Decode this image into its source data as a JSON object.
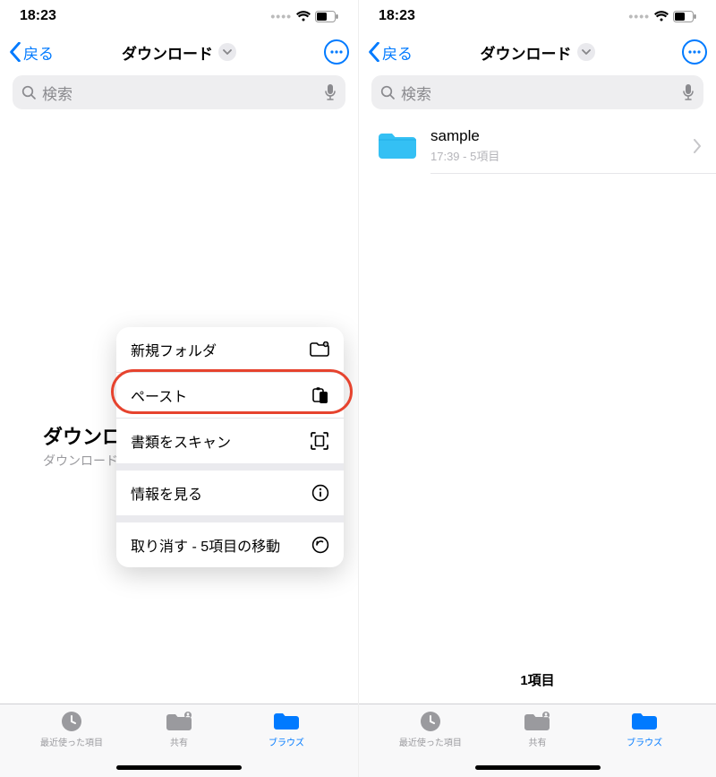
{
  "status": {
    "time": "18:23"
  },
  "nav": {
    "back": "戻る",
    "title": "ダウンロード"
  },
  "search": {
    "placeholder": "検索"
  },
  "empty": {
    "title": "ダウンロ",
    "subtitle": "ダウンロード"
  },
  "menu": {
    "newFolder": "新規フォルダ",
    "paste": "ペースト",
    "scan": "書類をスキャン",
    "info": "情報を見る",
    "undo": "取り消す - 5項目の移動"
  },
  "folder": {
    "name": "sample",
    "meta": "17:39 - 5項目"
  },
  "footer": {
    "count": "1項目"
  },
  "tabs": {
    "recents": "最近使った項目",
    "shared": "共有",
    "browse": "ブラウズ"
  },
  "colors": {
    "accent": "#007aff",
    "highlight": "#e6432e",
    "folderIcon": "#34c0f4"
  }
}
